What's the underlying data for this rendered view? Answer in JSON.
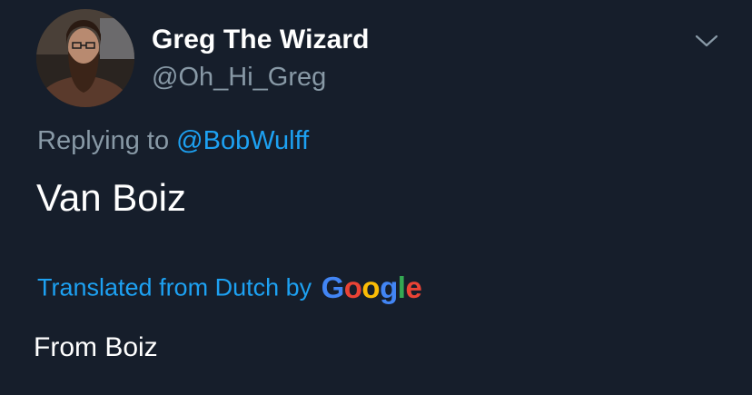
{
  "tweet": {
    "author": {
      "display_name": "Greg The Wizard",
      "handle": "@Oh_Hi_Greg",
      "avatar_icon": "avatar-photo"
    },
    "more_icon": "chevron-down-icon",
    "replying_prefix": "Replying to ",
    "replying_mention": "@BobWulff",
    "text": "Van Boiz",
    "translation": {
      "label": "Translated from Dutch by",
      "provider_letters": [
        "G",
        "o",
        "o",
        "g",
        "l",
        "e"
      ],
      "provider_colors": [
        "#4285f4",
        "#ea4335",
        "#fbbc05",
        "#4285f4",
        "#34a853",
        "#ea4335"
      ],
      "text": "From Boiz"
    }
  },
  "colors": {
    "background": "#161e2b",
    "primary_text": "#ffffff",
    "secondary_text": "#8899a6",
    "accent": "#1da1f2"
  }
}
